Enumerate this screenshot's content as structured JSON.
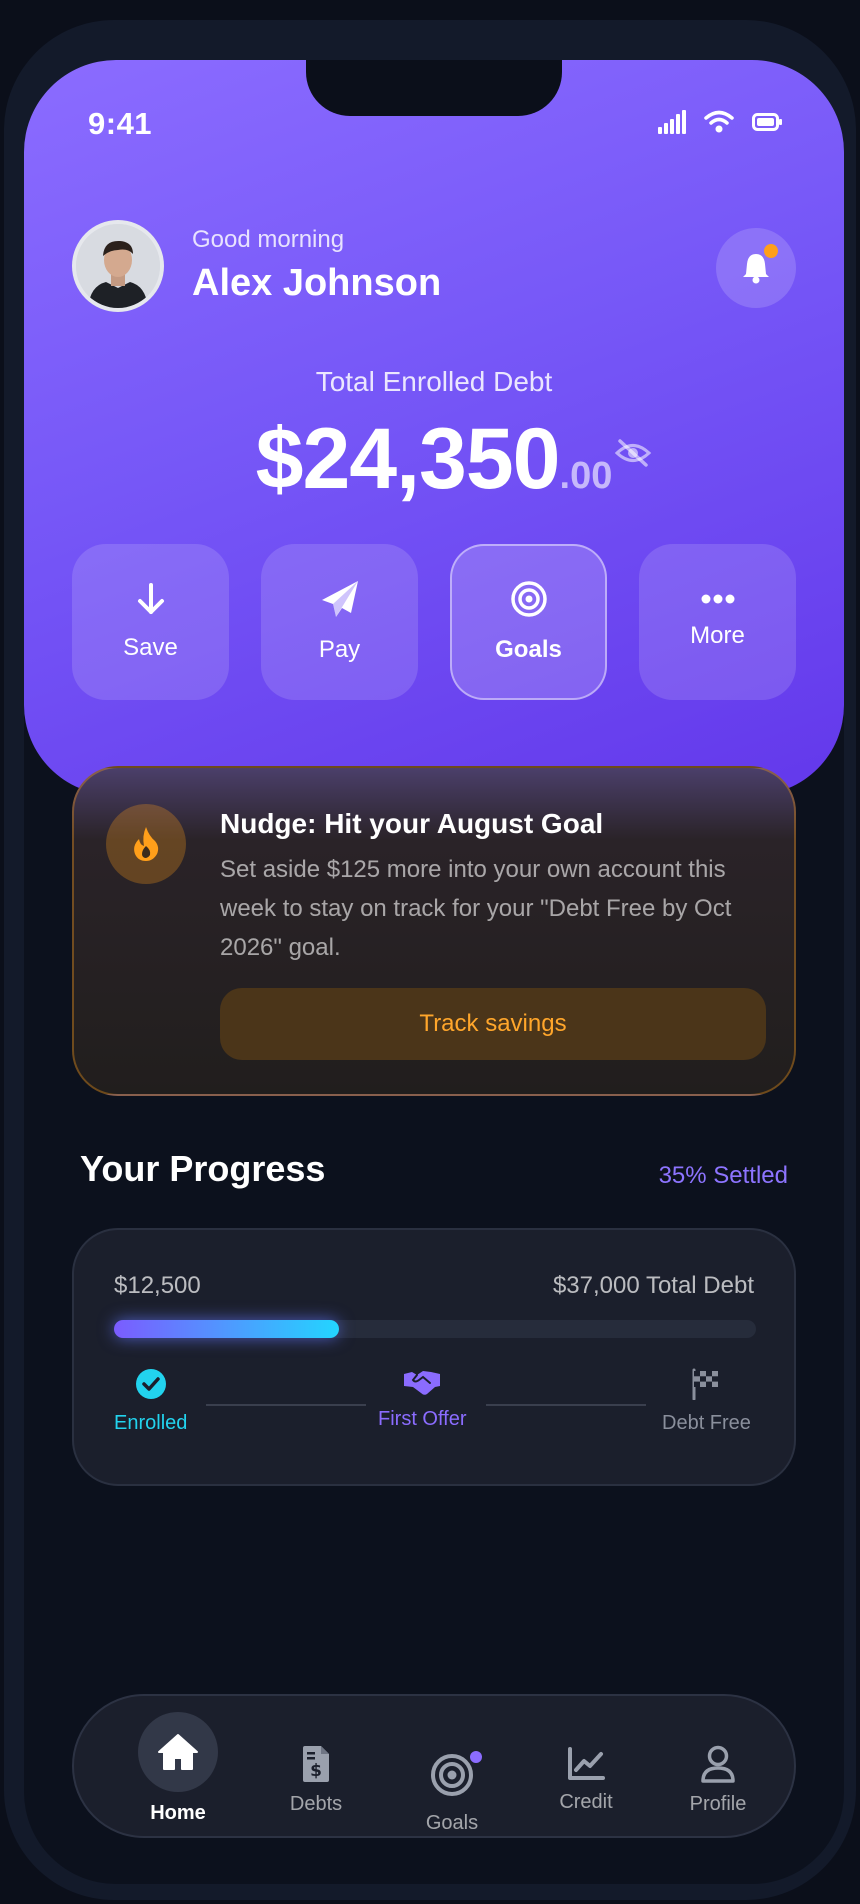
{
  "status_bar": {
    "time": "9:41"
  },
  "header": {
    "greeting": "Good morning",
    "user_name": "Alex Johnson"
  },
  "balance": {
    "label": "Total Enrolled Debt",
    "amount_main": "$24,350",
    "amount_cents": ".00"
  },
  "quick_actions": [
    {
      "label": "Save",
      "icon": "arrow-down-icon"
    },
    {
      "label": "Pay",
      "icon": "paper-plane-icon"
    },
    {
      "label": "Goals",
      "icon": "target-icon",
      "active": true
    },
    {
      "label": "More",
      "icon": "ellipsis-icon"
    }
  ],
  "nudge": {
    "title": "Nudge: Hit your August Goal",
    "body": "Set aside $125 more into your own account this week to stay on track for your \"Debt Free by Oct 2026\" goal.",
    "button": "Track savings",
    "icon": "fire-icon"
  },
  "progress": {
    "title": "Your Progress",
    "settled_label": "35% Settled",
    "amount_left": "$12,500",
    "amount_right": "$37,000 Total Debt",
    "fill_fraction": 0.35,
    "steps": [
      {
        "label": "Enrolled",
        "icon": "check-circle-icon",
        "color": "#22d3ee"
      },
      {
        "label": "First Offer",
        "icon": "handshake-icon",
        "color": "#8b6cff"
      },
      {
        "label": "Debt Free",
        "icon": "checkered-flag-icon",
        "color": "#8a8f9c"
      }
    ]
  },
  "bottom_nav": [
    {
      "label": "Home",
      "icon": "home-icon",
      "active": true
    },
    {
      "label": "Debts",
      "icon": "invoice-dollar-icon"
    },
    {
      "label": "Goals",
      "icon": "target-icon",
      "badge": true
    },
    {
      "label": "Credit",
      "icon": "chart-line-icon"
    },
    {
      "label": "Profile",
      "icon": "user-icon"
    }
  ],
  "colors": {
    "accent": "#7657f7",
    "warning": "#ffa62b",
    "success": "#22d3ee"
  }
}
